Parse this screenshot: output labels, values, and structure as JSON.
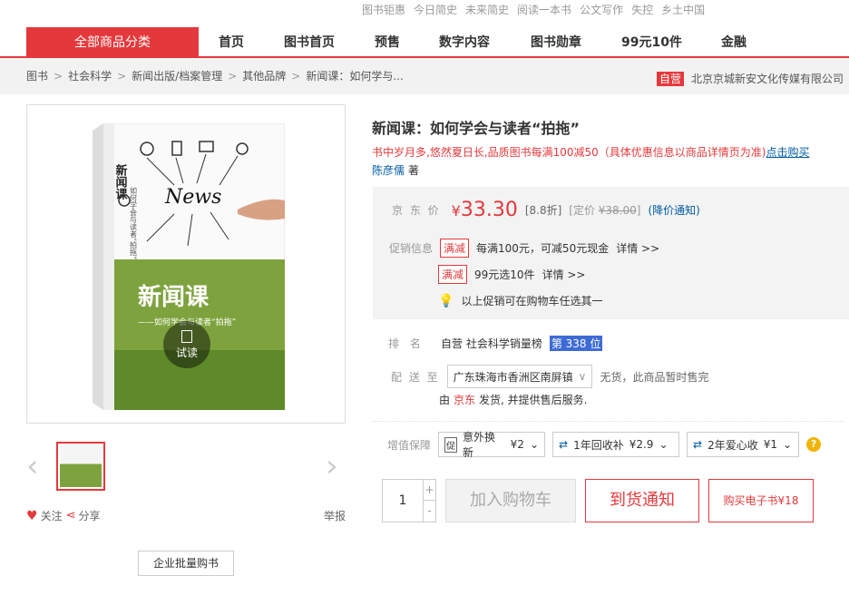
{
  "top_links": [
    "图书钜惠",
    "今日简史",
    "未来简史",
    "阅读一本书",
    "公文写作",
    "失控",
    "乡土中国"
  ],
  "nav": {
    "category": "全部商品分类",
    "items": [
      "首页",
      "图书首页",
      "预售",
      "数字内容",
      "图书勋章",
      "99元10件",
      "金融"
    ]
  },
  "breadcrumb": {
    "items": [
      "图书",
      "社会科学",
      "新闻出版/档案管理",
      "其他品牌",
      "新闻课：如何学与..."
    ],
    "self_badge": "自营",
    "shop_name": "北京京城新安文化传媒有限公司"
  },
  "gallery": {
    "try_read": "试读",
    "follow": "关注",
    "share": "分享",
    "report": "举报",
    "bulk_buy": "企业批量购书"
  },
  "book_cover": {
    "title_vertical": "新闻课",
    "subtitle_vertical": "如何学会与读者“拍拖”",
    "news_word": "News",
    "big_title": "新闻课",
    "subtitle": "——如何学会与读者“拍拖”"
  },
  "product": {
    "title": "新闻课：如何学会与读者“拍拖”",
    "promo_line": "书中岁月多,悠然夏日长,品质图书每满100减50（具体优惠信息以商品详情页为准)",
    "promo_link": "点击购买",
    "author": "陈彦儒",
    "author_suffix": "著"
  },
  "price": {
    "label": "京 东 价",
    "currency": "¥",
    "value": "33.30",
    "discount": "[8.8折]",
    "list_label": "[定价",
    "list_price": "¥38.00",
    "list_close": "]",
    "notify": "(降价通知)"
  },
  "promotions": {
    "label": "促销信息",
    "items": [
      {
        "tag": "满减",
        "text": "每满100元，可减50元现金",
        "detail": "详情 >>"
      },
      {
        "tag": "满减",
        "text": "99元选10件",
        "detail": "详情 >>"
      }
    ],
    "note": "以上促销可在购物车任选其一"
  },
  "rank": {
    "label": "排  名",
    "text": "自营 社会科学销量榜",
    "position": "第 338 位"
  },
  "delivery": {
    "label": "配 送 至",
    "location": "广东珠海市香洲区南屏镇",
    "status": "无货，此商品暂时售完",
    "from_prefix": "由",
    "from_shop": "京东",
    "from_suffix": "发货, 并提供售后服务."
  },
  "services": {
    "label": "增值保障",
    "items": [
      {
        "name": "意外换新",
        "price": "¥2"
      },
      {
        "name": "1年回收补",
        "price": "¥2.9"
      },
      {
        "name": "2年爱心收",
        "price": "¥1"
      }
    ]
  },
  "purchase": {
    "quantity": "1",
    "plus": "+",
    "minus": "-",
    "add_to_cart": "加入购物车",
    "arrival_notice": "到货通知",
    "buy_ebook": "购买电子书¥18"
  },
  "colors": {
    "accent": "#e4393c",
    "link": "#005aa0"
  }
}
